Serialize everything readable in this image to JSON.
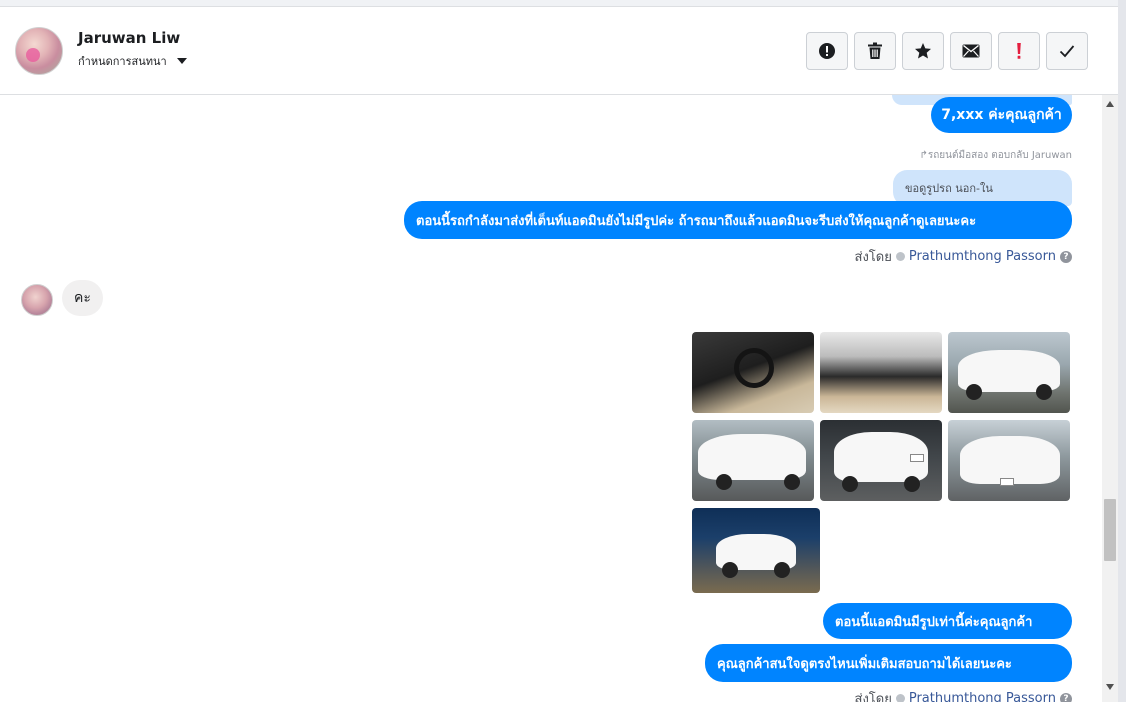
{
  "header": {
    "contact_name": "Jaruwan Liw",
    "subtitle": "กำหนดการสนทนา"
  },
  "toolbar": {
    "buttons": [
      {
        "name": "mark-spam",
        "icon": "exclamation-circle-icon"
      },
      {
        "name": "delete",
        "icon": "trash-icon"
      },
      {
        "name": "star",
        "icon": "star-icon"
      },
      {
        "name": "mark-unread",
        "icon": "envelope-icon"
      },
      {
        "name": "important",
        "icon": "red-exclamation-icon"
      },
      {
        "name": "done",
        "icon": "checkmark-icon"
      }
    ]
  },
  "conversation": {
    "msg_price": "7,xxx ค่ะคุณลูกค้า",
    "reply_reference": "รถยนต์มือสอง ตอบกลับ Jaruwan",
    "quoted_message": "ขอดูรูปรถ นอก-ใน",
    "msg_car_status": "ตอนนี้รถกำลังมาส่งที่เต็นท์แอดมินยังไม่มีรูปค่ะ ถ้ารถมาถึงแล้วแอดมินจะรีบส่งให้คุณลูกค้าดูเลยนะคะ",
    "sent_by_label": "ส่งโดย",
    "sent_by_name": "Prathumthong Passorn",
    "incoming_reply": "คะ",
    "photos": [
      {
        "subject": "steering-wheel-interior"
      },
      {
        "subject": "front-seats-interior"
      },
      {
        "subject": "front-view-white-sedan"
      },
      {
        "subject": "front-quarter-white-sedan"
      },
      {
        "subject": "rear-view-white-sedan"
      },
      {
        "subject": "front-view-white-sedan-2"
      },
      {
        "subject": "white-sedan-in-lot"
      }
    ],
    "msg_only_photos": "ตอนนี้แอดมินมีรูปเท่านี้ค่ะคุณลูกค้า",
    "msg_ask_more": "คุณลูกค้าสนใจดูตรงไหนเพิ่มเติมสอบถามได้เลยนะคะ",
    "sent_by_label_2": "ส่งโดย",
    "sent_by_name_2": "Prathumthong Passorn"
  },
  "colors": {
    "bubble_blue": "#0084ff",
    "quoted_bg": "#cfe4fb",
    "incoming_bg": "#f1f0f0",
    "important_red": "#e41e3f"
  }
}
